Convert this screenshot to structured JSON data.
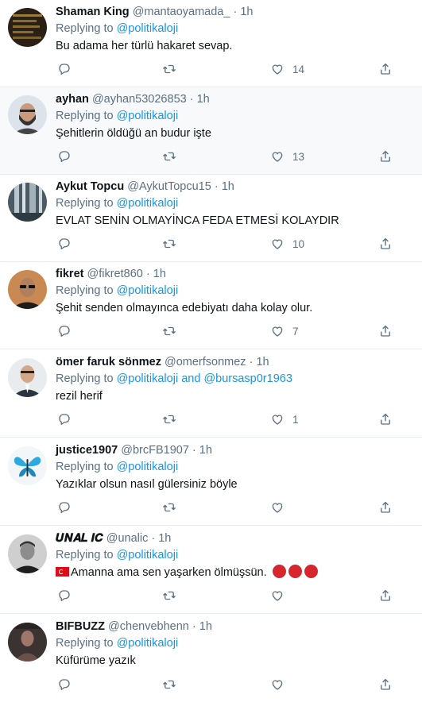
{
  "replies": [
    {
      "name": "Shaman King",
      "handle": "@mantaoyamada_",
      "time": "1h",
      "replying_label": "Replying to",
      "mentions": "@politikaloji",
      "text": "Bu adama her türlü hakaret sevap.",
      "likes": "14",
      "avatar": "dark-code-avatar"
    },
    {
      "name": "ayhan",
      "handle": "@ayhan53026853",
      "time": "1h",
      "replying_label": "Replying to",
      "mentions": "@politikaloji",
      "text": "Şehitlerin öldüğü an budur işte",
      "likes": "13",
      "avatar": "man-with-beard-avatar"
    },
    {
      "name": "Aykut Topcu",
      "handle": "@AykutTopcu15",
      "time": "1h",
      "replying_label": "Replying to",
      "mentions": "@politikaloji",
      "text": "EVLAT SENİN OLMAYİNCA FEDA ETMESİ KOLAYDIR",
      "likes": "10",
      "avatar": "waterfall-avatar"
    },
    {
      "name": "fikret",
      "handle": "@fikret860",
      "time": "1h",
      "replying_label": "Replying to",
      "mentions": "@politikaloji",
      "text": "Şehit senden olmayınca edebiyatı daha kolay olur.",
      "likes": "7",
      "avatar": "man-sunglasses-avatar"
    },
    {
      "name": "ömer faruk sönmez",
      "handle": "@omerfsonmez",
      "time": "1h",
      "replying_label": "Replying to",
      "mentions": "@politikaloji and @bursasp0r1963",
      "text": "rezil herif",
      "likes": "1",
      "avatar": "man-suit-avatar"
    },
    {
      "name": "justice1907",
      "handle": "@brcFB1907",
      "time": "1h",
      "replying_label": "Replying to",
      "mentions": "@politikaloji",
      "text": "Yazıklar olsun nasıl gülersiniz böyle",
      "likes": "",
      "avatar": "butterfly-avatar"
    },
    {
      "name": "𝑼𝑵𝑨𝑳 𝑰𝑪",
      "handle": "@unalic",
      "time": "1h",
      "replying_label": "Replying to",
      "mentions": "@politikaloji",
      "text": "Amanna ama sen yaşarken ölmüşsün.",
      "likes": "",
      "avatar": "man-portrait-avatar",
      "prefix_icon": "turkey-flag-icon",
      "suffix_icon": "angry-face-icon"
    },
    {
      "name": "BIFBUZZ",
      "handle": "@chenvebhenn",
      "time": "1h",
      "replying_label": "Replying to",
      "mentions": "@politikaloji",
      "text": "Küfürüme yazık",
      "likes": "",
      "avatar": "dark-figure-avatar"
    }
  ],
  "separator": "·",
  "colors": {
    "link": "#1b95e0",
    "secondary": "#5b7083",
    "divider": "#e6ecf0",
    "highlight_bg": "#f7f9fa"
  }
}
